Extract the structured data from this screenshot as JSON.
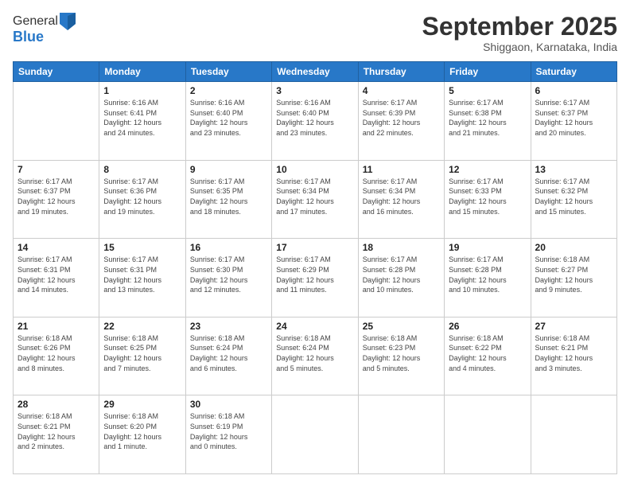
{
  "logo": {
    "general": "General",
    "blue": "Blue"
  },
  "header": {
    "month_year": "September 2025",
    "location": "Shiggaon, Karnataka, India"
  },
  "days_of_week": [
    "Sunday",
    "Monday",
    "Tuesday",
    "Wednesday",
    "Thursday",
    "Friday",
    "Saturday"
  ],
  "weeks": [
    [
      {
        "day": "",
        "info": ""
      },
      {
        "day": "1",
        "info": "Sunrise: 6:16 AM\nSunset: 6:41 PM\nDaylight: 12 hours\nand 24 minutes."
      },
      {
        "day": "2",
        "info": "Sunrise: 6:16 AM\nSunset: 6:40 PM\nDaylight: 12 hours\nand 23 minutes."
      },
      {
        "day": "3",
        "info": "Sunrise: 6:16 AM\nSunset: 6:40 PM\nDaylight: 12 hours\nand 23 minutes."
      },
      {
        "day": "4",
        "info": "Sunrise: 6:17 AM\nSunset: 6:39 PM\nDaylight: 12 hours\nand 22 minutes."
      },
      {
        "day": "5",
        "info": "Sunrise: 6:17 AM\nSunset: 6:38 PM\nDaylight: 12 hours\nand 21 minutes."
      },
      {
        "day": "6",
        "info": "Sunrise: 6:17 AM\nSunset: 6:37 PM\nDaylight: 12 hours\nand 20 minutes."
      }
    ],
    [
      {
        "day": "7",
        "info": "Sunrise: 6:17 AM\nSunset: 6:37 PM\nDaylight: 12 hours\nand 19 minutes."
      },
      {
        "day": "8",
        "info": "Sunrise: 6:17 AM\nSunset: 6:36 PM\nDaylight: 12 hours\nand 19 minutes."
      },
      {
        "day": "9",
        "info": "Sunrise: 6:17 AM\nSunset: 6:35 PM\nDaylight: 12 hours\nand 18 minutes."
      },
      {
        "day": "10",
        "info": "Sunrise: 6:17 AM\nSunset: 6:34 PM\nDaylight: 12 hours\nand 17 minutes."
      },
      {
        "day": "11",
        "info": "Sunrise: 6:17 AM\nSunset: 6:34 PM\nDaylight: 12 hours\nand 16 minutes."
      },
      {
        "day": "12",
        "info": "Sunrise: 6:17 AM\nSunset: 6:33 PM\nDaylight: 12 hours\nand 15 minutes."
      },
      {
        "day": "13",
        "info": "Sunrise: 6:17 AM\nSunset: 6:32 PM\nDaylight: 12 hours\nand 15 minutes."
      }
    ],
    [
      {
        "day": "14",
        "info": "Sunrise: 6:17 AM\nSunset: 6:31 PM\nDaylight: 12 hours\nand 14 minutes."
      },
      {
        "day": "15",
        "info": "Sunrise: 6:17 AM\nSunset: 6:31 PM\nDaylight: 12 hours\nand 13 minutes."
      },
      {
        "day": "16",
        "info": "Sunrise: 6:17 AM\nSunset: 6:30 PM\nDaylight: 12 hours\nand 12 minutes."
      },
      {
        "day": "17",
        "info": "Sunrise: 6:17 AM\nSunset: 6:29 PM\nDaylight: 12 hours\nand 11 minutes."
      },
      {
        "day": "18",
        "info": "Sunrise: 6:17 AM\nSunset: 6:28 PM\nDaylight: 12 hours\nand 10 minutes."
      },
      {
        "day": "19",
        "info": "Sunrise: 6:17 AM\nSunset: 6:28 PM\nDaylight: 12 hours\nand 10 minutes."
      },
      {
        "day": "20",
        "info": "Sunrise: 6:18 AM\nSunset: 6:27 PM\nDaylight: 12 hours\nand 9 minutes."
      }
    ],
    [
      {
        "day": "21",
        "info": "Sunrise: 6:18 AM\nSunset: 6:26 PM\nDaylight: 12 hours\nand 8 minutes."
      },
      {
        "day": "22",
        "info": "Sunrise: 6:18 AM\nSunset: 6:25 PM\nDaylight: 12 hours\nand 7 minutes."
      },
      {
        "day": "23",
        "info": "Sunrise: 6:18 AM\nSunset: 6:24 PM\nDaylight: 12 hours\nand 6 minutes."
      },
      {
        "day": "24",
        "info": "Sunrise: 6:18 AM\nSunset: 6:24 PM\nDaylight: 12 hours\nand 5 minutes."
      },
      {
        "day": "25",
        "info": "Sunrise: 6:18 AM\nSunset: 6:23 PM\nDaylight: 12 hours\nand 5 minutes."
      },
      {
        "day": "26",
        "info": "Sunrise: 6:18 AM\nSunset: 6:22 PM\nDaylight: 12 hours\nand 4 minutes."
      },
      {
        "day": "27",
        "info": "Sunrise: 6:18 AM\nSunset: 6:21 PM\nDaylight: 12 hours\nand 3 minutes."
      }
    ],
    [
      {
        "day": "28",
        "info": "Sunrise: 6:18 AM\nSunset: 6:21 PM\nDaylight: 12 hours\nand 2 minutes."
      },
      {
        "day": "29",
        "info": "Sunrise: 6:18 AM\nSunset: 6:20 PM\nDaylight: 12 hours\nand 1 minute."
      },
      {
        "day": "30",
        "info": "Sunrise: 6:18 AM\nSunset: 6:19 PM\nDaylight: 12 hours\nand 0 minutes."
      },
      {
        "day": "",
        "info": ""
      },
      {
        "day": "",
        "info": ""
      },
      {
        "day": "",
        "info": ""
      },
      {
        "day": "",
        "info": ""
      }
    ]
  ]
}
